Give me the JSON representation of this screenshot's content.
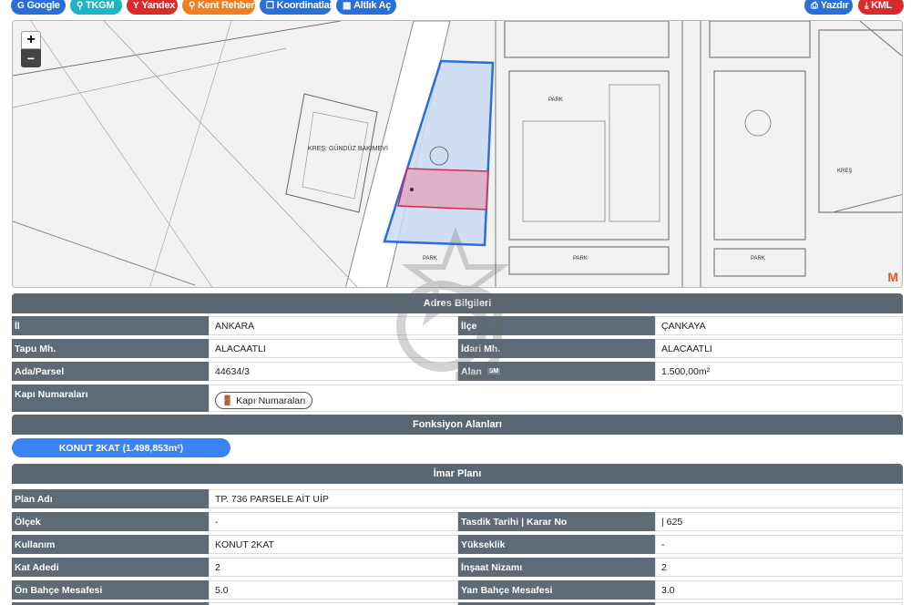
{
  "toolbar": {
    "google": "Google",
    "tkgm": "TKGM",
    "yandex": "Yandex",
    "kent": "Kent Rehberi",
    "koordinatlar": "Koordinatlar",
    "altlik": "Altlık Aç",
    "yazdir": "Yazdır",
    "kml": "KML"
  },
  "map": {
    "zoom_in": "+",
    "zoom_out": "−",
    "labels": {
      "kres_label": "KREŞ: GÜNDÜZ BAKIMEVİ",
      "park1": "PARK",
      "park2": "PARK",
      "park3": "PARK",
      "park4": "PARK",
      "kres2": "KREŞ"
    },
    "logo": "M"
  },
  "adres": {
    "header": "Adres Bilgileri",
    "il_label": "İl",
    "il_value": "ANKARA",
    "ilce_label": "İlçe",
    "ilce_value": "ÇANKAYA",
    "tapu_label": "Tapu Mh.",
    "tapu_value": "ALACAATLI",
    "idari_label": "İdari Mh.",
    "idari_value": "ALACAATLI",
    "adaparsel_label": "Ada/Parsel",
    "adaparsel_value": "44634/3",
    "alan_label": "Alan",
    "alan_badge": "SM",
    "alan_value": "1.500,00m²",
    "kapi_label": "Kapı Numaraları",
    "kapi_button": "Kapı Numaraları"
  },
  "fonksiyon": {
    "header": "Fonksiyon Alanları",
    "pill": "KONUT 2KAT (1.498,853m²)"
  },
  "imar": {
    "header": "İmar Planı",
    "plan_adi_label": "Plan Adı",
    "plan_adi_value": "TP. 736 PARSELE AİT UİP",
    "olcek_label": "Ölçek",
    "olcek_value": "-",
    "tasdik_label": "Tasdik Tarihi | Karar No",
    "tasdik_value": "| 625",
    "kullanim_label": "Kullanım",
    "kullanim_value": "KONUT 2KAT",
    "yukseklik_label": "Yükseklik",
    "yukseklik_value": "-",
    "kat_label": "Kat Adedi",
    "kat_value": "2",
    "insaat_label": "İnşaat Nizamı",
    "insaat_value": "2",
    "on_label": "Ön Bahçe Mesafesi",
    "on_value": "5.0",
    "yan_label": "Yan Bahçe Mesafesi",
    "yan_value": "3.0"
  },
  "colors": {
    "primary": "#2a6fd8",
    "danger": "#d92b2b",
    "info": "#1fb3c6",
    "warning": "#f27f1f",
    "header_bg": "#5a6672",
    "parcel_fill": "#c9daf2",
    "parcel_stroke": "#2a6fd8",
    "selection": "#d9265a"
  }
}
